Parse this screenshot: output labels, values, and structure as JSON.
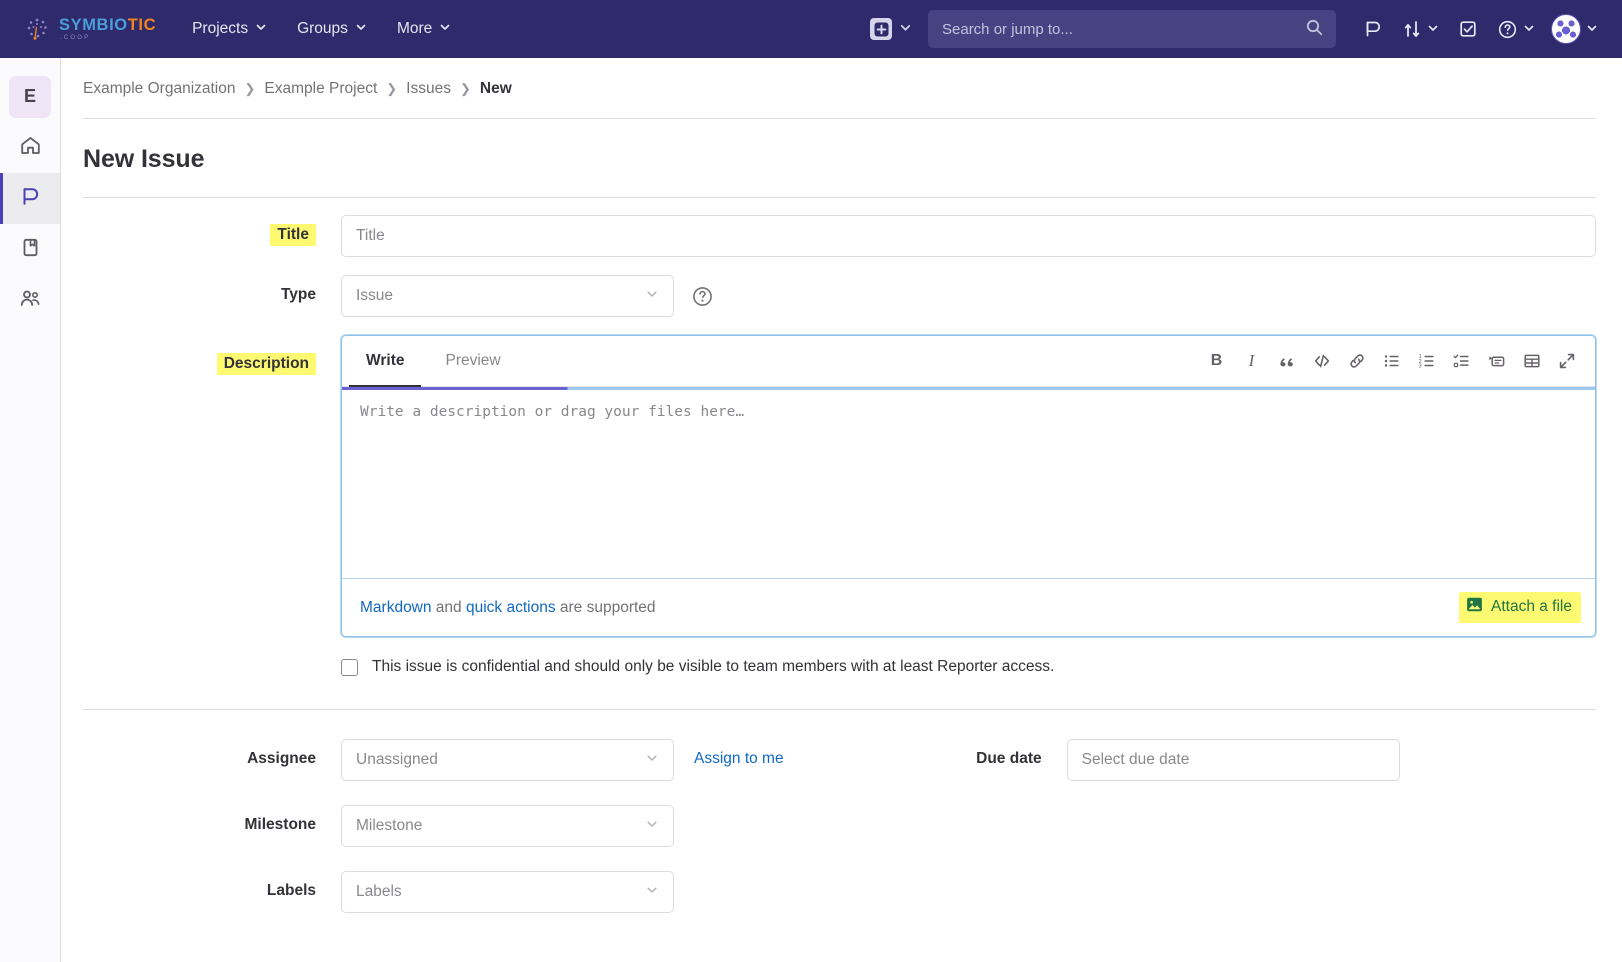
{
  "navbar": {
    "brand": {
      "part1": "SYMBIO",
      "part2": "TIC",
      "sub": ".COOP",
      "icon": "symbiotic-logo-icon"
    },
    "links": [
      {
        "label": "Projects",
        "name": "nav-projects"
      },
      {
        "label": "Groups",
        "name": "nav-groups"
      },
      {
        "label": "More",
        "name": "nav-more"
      }
    ],
    "create_icon": "plus-square-icon",
    "search": {
      "placeholder": "Search or jump to...",
      "icon": "search-icon"
    },
    "icons": [
      {
        "name": "issues-icon"
      },
      {
        "name": "merge-requests-icon"
      },
      {
        "name": "todos-icon"
      },
      {
        "name": "help-icon"
      },
      {
        "name": "user-avatar"
      }
    ]
  },
  "rail": {
    "avatar_letter": "E",
    "items": [
      {
        "name": "rail-item-home",
        "icon": "home-icon",
        "active": false
      },
      {
        "name": "rail-item-issues",
        "icon": "issues-icon",
        "active": true
      },
      {
        "name": "rail-item-repository",
        "icon": "book-icon",
        "active": false
      },
      {
        "name": "rail-item-members",
        "icon": "members-icon",
        "active": false
      }
    ]
  },
  "breadcrumb": [
    {
      "label": "Example Organization",
      "current": false
    },
    {
      "label": "Example Project",
      "current": false
    },
    {
      "label": "Issues",
      "current": false
    },
    {
      "label": "New",
      "current": true
    }
  ],
  "page": {
    "title": "New Issue"
  },
  "form": {
    "title": {
      "label": "Title",
      "placeholder": "Title",
      "value": "",
      "highlighted": true
    },
    "type": {
      "label": "Type",
      "value": "Issue",
      "help_icon": "question-circle-icon"
    },
    "description": {
      "label": "Description",
      "highlighted": true,
      "tabs": [
        {
          "label": "Write",
          "active": true
        },
        {
          "label": "Preview",
          "active": false
        }
      ],
      "placeholder": "Write a description or drag your files here…",
      "value": "",
      "toolbar": [
        {
          "name": "bold-icon",
          "glyph": "B"
        },
        {
          "name": "italic-icon",
          "glyph": "I"
        },
        {
          "name": "quote-icon",
          "glyph": "”"
        },
        {
          "name": "code-icon",
          "glyph": "</>"
        },
        {
          "name": "link-icon",
          "glyph": "link"
        },
        {
          "name": "bullet-list-icon",
          "glyph": "ul"
        },
        {
          "name": "numbered-list-icon",
          "glyph": "ol"
        },
        {
          "name": "task-list-icon",
          "glyph": "tl"
        },
        {
          "name": "collapsible-section-icon",
          "glyph": "cs"
        },
        {
          "name": "table-icon",
          "glyph": "tb"
        },
        {
          "name": "fullscreen-icon",
          "glyph": "fs"
        }
      ],
      "footer": {
        "markdown_link": "Markdown",
        "and_text": " and ",
        "quick_actions_link": "quick actions",
        "suffix_text": " are supported",
        "attach_label": "Attach a file",
        "attach_icon": "image-icon",
        "attach_highlighted": true
      }
    },
    "confidential": {
      "checked": false,
      "label": "This issue is confidential and should only be visible to team members with at least Reporter access."
    },
    "assignee": {
      "label": "Assignee",
      "value": "Unassigned",
      "action": "Assign to me"
    },
    "due_date": {
      "label": "Due date",
      "placeholder": "Select due date"
    },
    "milestone": {
      "label": "Milestone",
      "value": "Milestone"
    },
    "labels": {
      "label": "Labels",
      "value": "Labels"
    }
  },
  "colors": {
    "navbar_bg": "#2f2a6b",
    "accent_blue": "#1068bf",
    "highlight_yellow": "#fdfa72",
    "attach_green": "#217645",
    "active_rail": "#4b41b5"
  }
}
